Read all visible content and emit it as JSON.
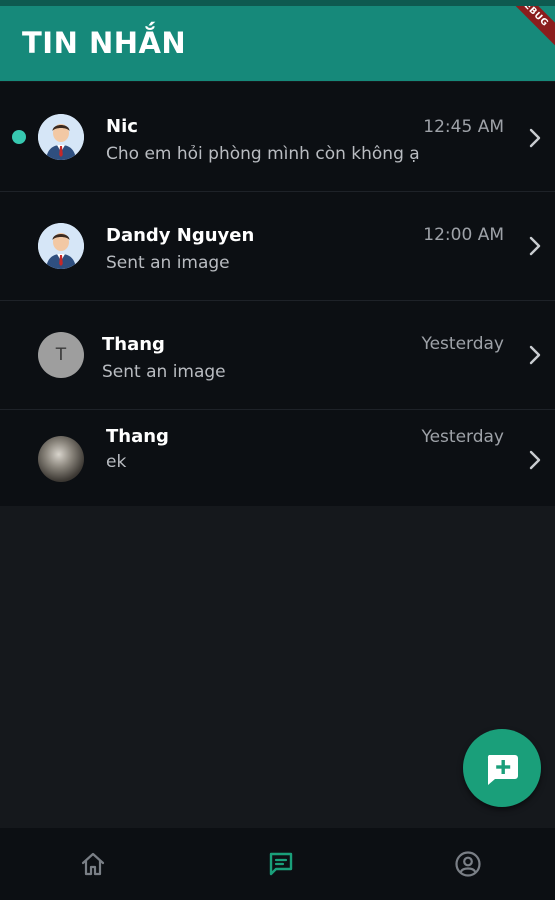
{
  "app_bar": {
    "title": "TIN NHẮN",
    "debug_badge": "DEBUG"
  },
  "colors": {
    "app_bar": "#16897a",
    "list_bg": "#0c0f13",
    "page_bg": "#15181c",
    "accent": "#1a9f7a",
    "unread_dot": "#37c8b0"
  },
  "conversations": [
    {
      "name": "Nic",
      "preview": "Cho em hỏi phòng mình còn không ạ",
      "time": "12:45 AM",
      "unread": true,
      "avatar": "user-icon"
    },
    {
      "name": "Dandy Nguyen",
      "preview": "Sent an image",
      "time": "12:00 AM",
      "unread": false,
      "avatar": "user-icon"
    },
    {
      "name": "Thang",
      "preview": "Sent an image",
      "time": "Yesterday",
      "unread": false,
      "avatar": "letter",
      "avatar_letter": "T"
    },
    {
      "name": "Thang",
      "preview": "ek",
      "time": "Yesterday",
      "unread": false,
      "avatar": "photo"
    }
  ],
  "fab": {
    "icon": "new-message-icon"
  },
  "bottom_nav": [
    {
      "icon": "home-icon",
      "active": false
    },
    {
      "icon": "chat-icon",
      "active": true
    },
    {
      "icon": "account-icon",
      "active": false
    }
  ]
}
